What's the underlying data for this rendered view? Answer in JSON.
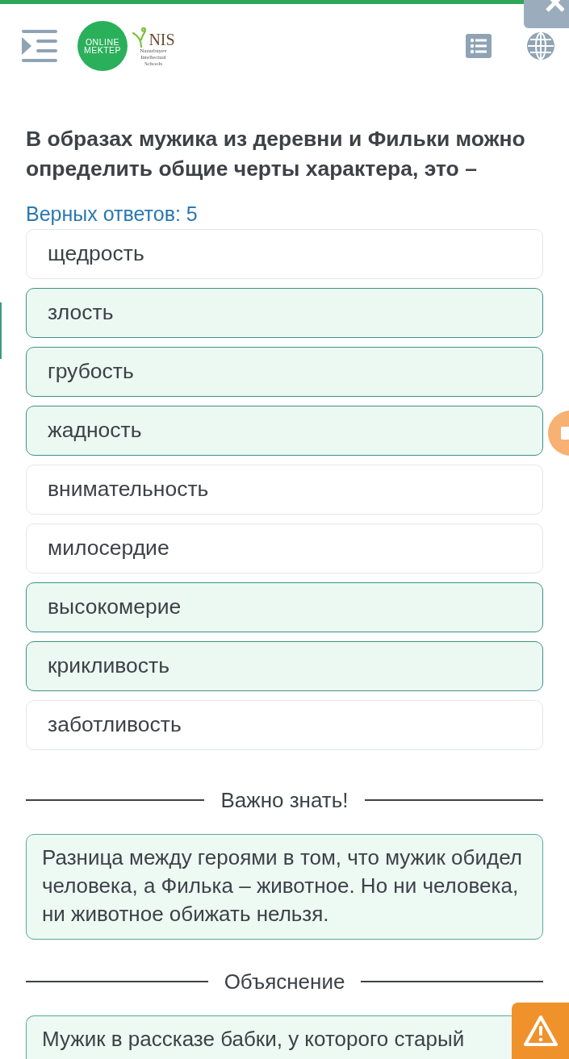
{
  "logo": {
    "line_1": "ONLINE",
    "line_2": "MEKTEP"
  },
  "partner_logo": {
    "title": "NIS",
    "subtitle": [
      "Nazarbayev",
      "Intellectual",
      "Schools"
    ]
  },
  "question": "В образах мужика из деревни и Фильки можно определить общие черты характера, это –",
  "answers_count": "Верных ответов: 5",
  "options": [
    {
      "label": "щедрость",
      "selected": false
    },
    {
      "label": "злость",
      "selected": true
    },
    {
      "label": "грубость",
      "selected": true
    },
    {
      "label": "жадность",
      "selected": true
    },
    {
      "label": "внимательность",
      "selected": false
    },
    {
      "label": "милосердие",
      "selected": false
    },
    {
      "label": "высокомерие",
      "selected": true
    },
    {
      "label": "крикливость",
      "selected": true
    },
    {
      "label": "заботливость",
      "selected": false
    }
  ],
  "sections": [
    {
      "heading": "Важно знать!",
      "text": "Разница между героями в том, что мужик обидел человека, а Филька – животное. Но ни человека, ни животное обижать нельзя."
    },
    {
      "heading": "Объяснение",
      "text": "Мужик в рассказе бабки, у которого старый"
    }
  ]
}
